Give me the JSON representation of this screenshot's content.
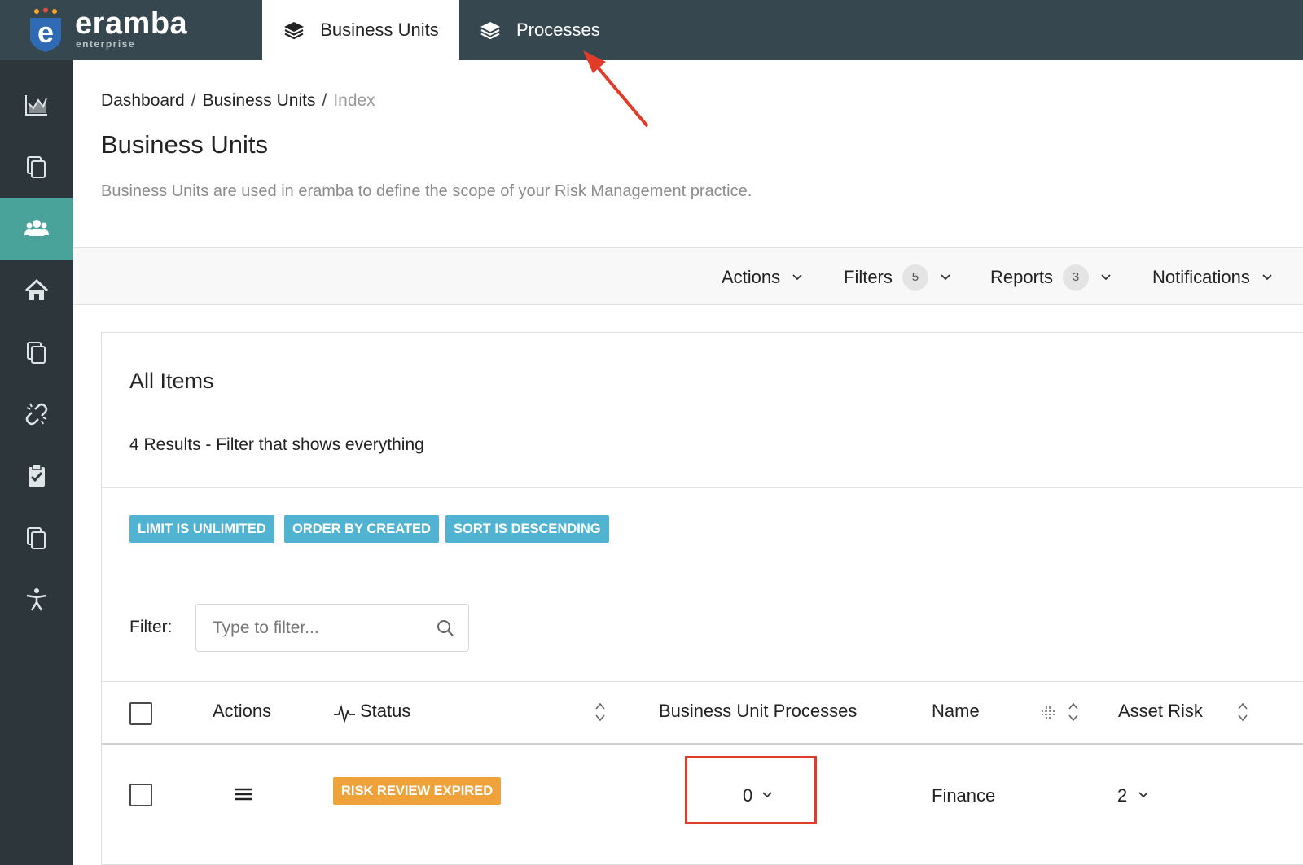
{
  "app": {
    "logo_text": "eramba",
    "logo_sub": "enterprise"
  },
  "tabs": [
    {
      "label": "Business Units",
      "active": true
    },
    {
      "label": "Processes",
      "active": false
    }
  ],
  "sidebar": {
    "items": [
      {
        "icon": "chart-icon"
      },
      {
        "icon": "copy-icon"
      },
      {
        "icon": "users-icon",
        "active": true
      },
      {
        "icon": "home-icon"
      },
      {
        "icon": "copy-icon"
      },
      {
        "icon": "broken-link-icon"
      },
      {
        "icon": "clipboard-check-icon"
      },
      {
        "icon": "copy-icon"
      },
      {
        "icon": "accessibility-icon"
      }
    ]
  },
  "breadcrumb": {
    "items": [
      "Dashboard",
      "Business Units"
    ],
    "current": "Index",
    "separator": "/"
  },
  "page": {
    "title": "Business Units",
    "description": "Business Units are used in eramba to define the scope of your Risk Management practice."
  },
  "toolbar": {
    "actions": "Actions",
    "filters": "Filters",
    "filters_count": "5",
    "reports": "Reports",
    "reports_count": "3",
    "notifications": "Notifications"
  },
  "card": {
    "title": "All Items",
    "subtitle": "4 Results - Filter that shows everything",
    "pills": [
      "LIMIT IS UNLIMITED",
      "ORDER BY CREATED",
      "SORT IS DESCENDING"
    ],
    "filter_label": "Filter:",
    "filter_placeholder": "Type to filter...",
    "filter_value": ""
  },
  "table": {
    "headers": {
      "actions": "Actions",
      "status": "Status",
      "processes": "Business Unit Processes",
      "name": "Name",
      "asset_risk": "Asset Risk"
    },
    "rows": [
      {
        "status": "RISK REVIEW EXPIRED",
        "processes": "0",
        "name": "Finance",
        "asset_risk": "2"
      }
    ]
  },
  "colors": {
    "topbar": "#37474f",
    "sidebar": "#2c363b",
    "sidebar_active": "#4aa39a",
    "pill": "#4fb3d1",
    "status_warning": "#f0a23a",
    "annotation": "#e23b2a"
  }
}
